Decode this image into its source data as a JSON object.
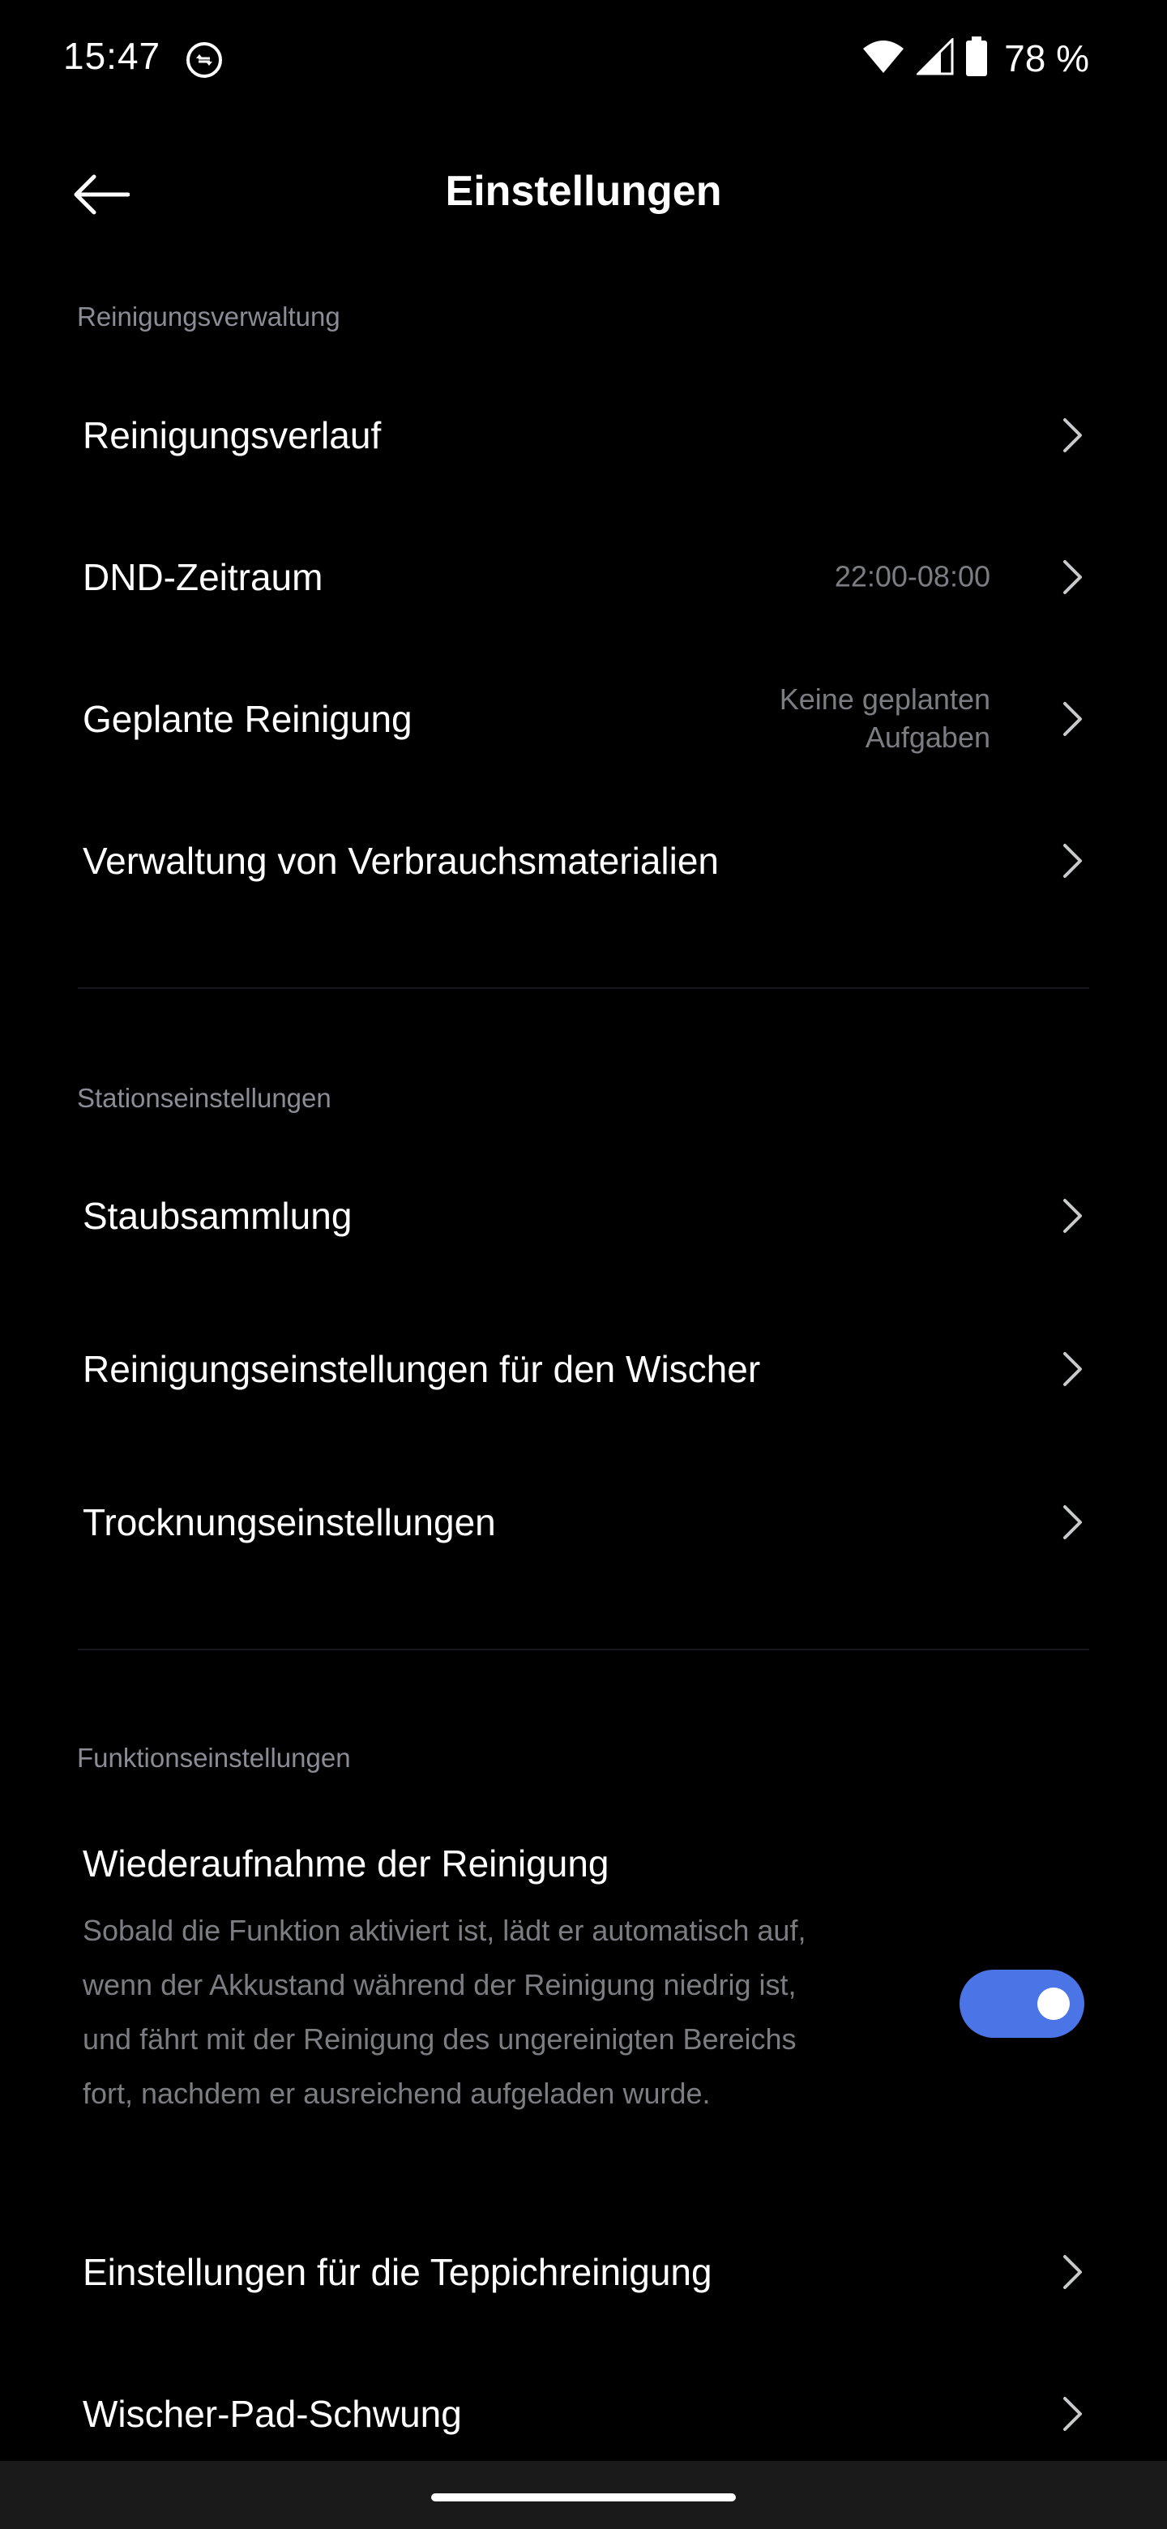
{
  "status_bar": {
    "time": "15:47",
    "battery_text": "78 %",
    "icons": [
      "sync-icon",
      "wifi-icon",
      "signal-icon",
      "battery-icon"
    ]
  },
  "header": {
    "title": "Einstellungen",
    "back_icon": "arrow-left-icon"
  },
  "sections": [
    {
      "label": "Reinigungsverwaltung",
      "items": [
        {
          "label": "Reinigungsverlauf",
          "value": ""
        },
        {
          "label": "DND-Zeitraum",
          "value": "22:00-08:00"
        },
        {
          "label": "Geplante Reinigung",
          "value": "Keine geplanten\nAufgaben"
        },
        {
          "label": "Verwaltung von Verbrauchsmaterialien",
          "value": ""
        }
      ]
    },
    {
      "label": "Stationseinstellungen",
      "items": [
        {
          "label": "Staubsammlung"
        },
        {
          "label": "Reinigungseinstellungen für den Wischer"
        },
        {
          "label": "Trocknungseinstellungen"
        }
      ]
    },
    {
      "label": "Funktionseinstellungen",
      "feature": {
        "title": "Wiederaufnahme der Reinigung",
        "description": "Sobald die Funktion aktiviert ist, lädt er automatisch auf, wenn der Akkustand während der Reinigung niedrig ist, und fährt mit der Reinigung des ungereinigten Bereichs fort, nachdem er ausreichend aufgeladen wurde.",
        "enabled": true
      },
      "items": [
        {
          "label": "Einstellungen für die Teppichreinigung"
        },
        {
          "label": "Wischer-Pad-Schwung"
        }
      ]
    }
  ],
  "colors": {
    "background": "#000000",
    "accent": "#4b74e6",
    "secondary_text": "#7c7d82",
    "section_label": "#8a8c96"
  }
}
